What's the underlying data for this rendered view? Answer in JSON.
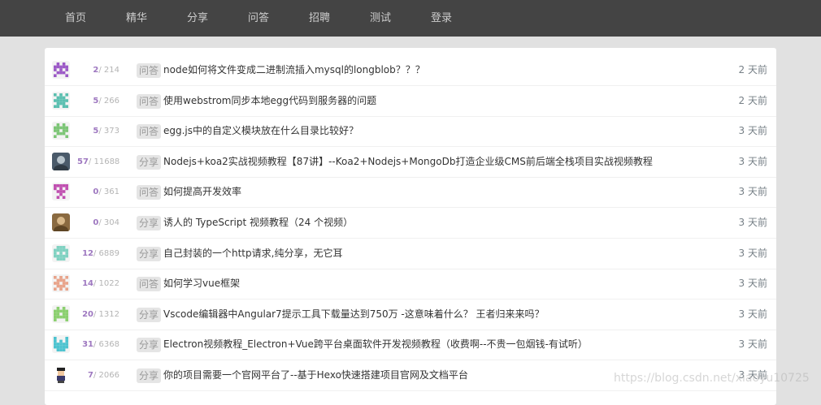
{
  "nav": {
    "items": [
      {
        "label": "首页",
        "name": "nav-item-home"
      },
      {
        "label": "精华",
        "name": "nav-item-essence"
      },
      {
        "label": "分享",
        "name": "nav-item-share"
      },
      {
        "label": "问答",
        "name": "nav-item-ask"
      },
      {
        "label": "招聘",
        "name": "nav-item-jobs"
      },
      {
        "label": "测试",
        "name": "nav-item-test"
      },
      {
        "label": "登录",
        "name": "nav-item-login"
      }
    ]
  },
  "topics": [
    {
      "replies": "2",
      "visits": "214",
      "tag": "问答",
      "title": "node如何将文件变成二进制流插入mysql的longblob？？？",
      "time": "2 天前",
      "avatar": "pixel-purple",
      "color": "#9b59c6"
    },
    {
      "replies": "5",
      "visits": "266",
      "tag": "问答",
      "title": "使用webstrom同步本地egg代码到服务器的问题",
      "time": "2 天前",
      "avatar": "pixel-teal",
      "color": "#5bbfb0"
    },
    {
      "replies": "5",
      "visits": "373",
      "tag": "问答",
      "title": "egg.js中的自定义模块放在什么目录比较好？",
      "time": "3 天前",
      "avatar": "pixel-green",
      "color": "#7cc576"
    },
    {
      "replies": "57",
      "visits": "11688",
      "tag": "分享",
      "title": "Nodejs+koa2实战视频教程【87讲】--Koa2+Nodejs+MongoDb打造企业级CMS前后端全栈项目实战视频教程",
      "time": "3 天前",
      "avatar": "photo-dark",
      "color": "#4a5a6a"
    },
    {
      "replies": "0",
      "visits": "361",
      "tag": "问答",
      "title": "如何提高开发效率",
      "time": "3 天前",
      "avatar": "pixel-magenta",
      "color": "#c04fb0"
    },
    {
      "replies": "0",
      "visits": "304",
      "tag": "分享",
      "title": "诱人的 TypeScript 视频教程（24 个视频）",
      "time": "3 天前",
      "avatar": "photo-brown",
      "color": "#8a6a40"
    },
    {
      "replies": "12",
      "visits": "6889",
      "tag": "分享",
      "title": "自己封装的一个http请求,纯分享，无它耳",
      "time": "3 天前",
      "avatar": "pixel-mint",
      "color": "#7fd1c1"
    },
    {
      "replies": "14",
      "visits": "1022",
      "tag": "问答",
      "title": "如何学习vue框架",
      "time": "3 天前",
      "avatar": "pixel-salmon",
      "color": "#e8a38a"
    },
    {
      "replies": "20",
      "visits": "1312",
      "tag": "分享",
      "title": "Vscode编辑器中Angular7提示工具下载量达到750万 -这意味着什么？ 王者归来来吗？",
      "time": "3 天前",
      "avatar": "pixel-lime",
      "color": "#8bcf6f"
    },
    {
      "replies": "31",
      "visits": "6368",
      "tag": "分享",
      "title": "Electron视频教程_Electron+Vue跨平台桌面软件开发视频教程（收费啊--不贵一包烟钱-有试听）",
      "time": "3 天前",
      "avatar": "pixel-cyan",
      "color": "#4cc3cf"
    },
    {
      "replies": "7",
      "visits": "2066",
      "tag": "分享",
      "title": "你的项目需要一个官网平台了--基于Hexo快速搭建项目官网及文档平台",
      "time": "3 天前",
      "avatar": "cartoon-person",
      "color": "#3a3a6a"
    }
  ],
  "watermark": "https://blog.csdn.net/xiaoyu10725"
}
